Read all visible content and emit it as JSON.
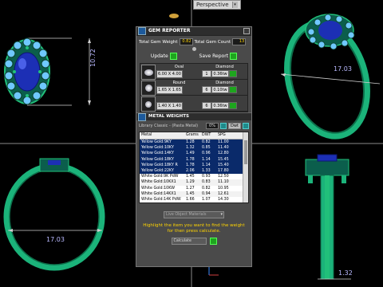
{
  "viewport": {
    "view_mode": "Perspective"
  },
  "dimensions": {
    "front_height": "10.72",
    "side_width": "17.03",
    "top_width": "17.03",
    "side_height": "1.32"
  },
  "gem_reporter": {
    "title": "GEM REPORTER",
    "total_gem_weight_label": "Total Gem Weight",
    "total_gem_weight_value": "0.82",
    "total_gem_count_label": "Total Gem Count",
    "total_gem_count_value": "13",
    "update_label": "Update",
    "save_report_label": "Save Report",
    "gems": [
      {
        "shape": "Oval",
        "size": "6.00 X 4.00",
        "material": "Diamond",
        "qty": "1",
        "carat": "0.36tw"
      },
      {
        "shape": "Round",
        "size": "1.65 X 1.65",
        "material": "Diamond",
        "qty": "6",
        "carat": "0.10tw"
      },
      {
        "shape": "",
        "size": "1.40 X 1.40",
        "material": "",
        "qty": "6",
        "carat": "0.36tw"
      }
    ]
  },
  "metal_weights": {
    "title": "METAL WEIGHTS",
    "library": "Library Classic - (Pasta Metal)",
    "percent": "0%",
    "unit": "Dwt",
    "columns": [
      "Metal",
      "Grams",
      "DWT",
      "SPG"
    ],
    "rows": [
      [
        "Yellow Gold:9KY",
        "1.28",
        "0.82",
        "11.00"
      ],
      [
        "Yellow Gold:10KY",
        "1.32",
        "0.85",
        "11.40"
      ],
      [
        "Yellow Gold:14KY",
        "1.49",
        "0.96",
        "12.80"
      ],
      [
        "Yellow Gold:18KY",
        "1.78",
        "1.14",
        "15.45"
      ],
      [
        "Yellow Gold:18KY R",
        "1.78",
        "1.14",
        "15.40"
      ],
      [
        "Yellow Gold:22KY",
        "2.06",
        "1.33",
        "17.80"
      ],
      [
        "White Gold:9K PdW",
        "1.45",
        "0.93",
        "12.50"
      ],
      [
        "White Gold:10KX1",
        "1.29",
        "0.83",
        "11.10"
      ],
      [
        "White Gold:10KW",
        "1.27",
        "0.82",
        "10.95"
      ],
      [
        "White Gold:14KX1",
        "1.45",
        "0.94",
        "12.61"
      ],
      [
        "White Gold:14K PdW",
        "1.66",
        "1.07",
        "14.30"
      ]
    ],
    "object_select": "Live Object Materials",
    "hint": "Highlight the item you want to find the weight for then press calculate.",
    "calculate_label": "Calculate"
  }
}
